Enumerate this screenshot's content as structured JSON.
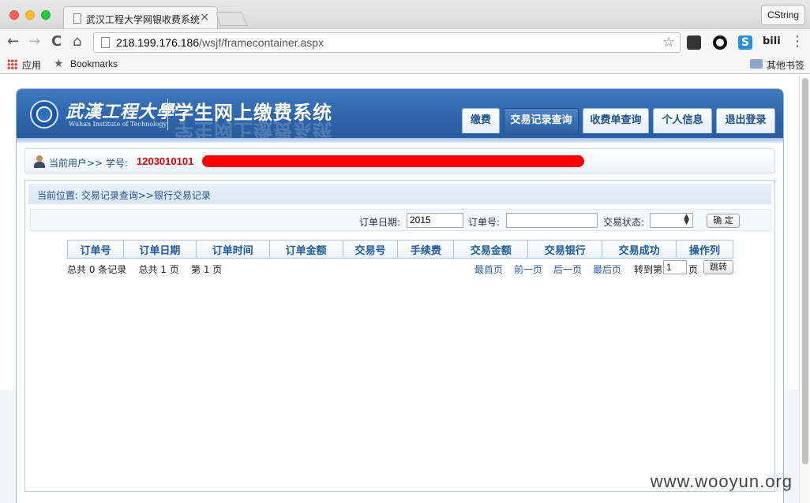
{
  "browser": {
    "tab_title": "武汉工程大学网银收费系统",
    "tab_close": "×",
    "profile_button": "CString",
    "url_host": "218.199.176.186",
    "url_path": "/wsjf/framecontainer.aspx",
    "nav_back": "←",
    "nav_forward": "→",
    "nav_reload": "C",
    "nav_home": "⌂",
    "bookmark_star": "☆",
    "ext_s": "S",
    "ext_bili": "bili",
    "menu": "⋮",
    "bookmarks": {
      "apps_label": "应用",
      "bookmarks_label": "Bookmarks",
      "other_label": "其他书签",
      "star": "★"
    }
  },
  "header": {
    "logo_cn": "武漢工程大學",
    "logo_en": "Wuhan Institute of Technology",
    "system_title": "学生网上缴费系统",
    "nav": {
      "pay": "缴费",
      "records": "交易记录查询",
      "receipts": "收费单查询",
      "profile": "个人信息",
      "logout": "退出登录"
    },
    "active_tab": "交易记录查询"
  },
  "user": {
    "label": "当前用户>> 学号:",
    "student_id": "1203010101"
  },
  "breadcrumb": "当前位置: 交易记录查询>>银行交易记录",
  "filter": {
    "date_label": "订单日期:",
    "date_value": "2015",
    "order_label": "订单号:",
    "order_value": "",
    "status_label": "交易状态:",
    "status_value": "",
    "confirm": "确 定"
  },
  "table": {
    "columns": [
      "订单号",
      "订单日期",
      "订单时间",
      "订单金额",
      "交易号",
      "手续费",
      "交易金额",
      "交易银行",
      "交易成功",
      "操作列"
    ],
    "rows": []
  },
  "pager": {
    "summary": "总共 0 条记录    总共 1 页    第 1 页",
    "first": "最首页",
    "prev": "前一页",
    "next": "后一页",
    "last": "最后页",
    "goto_label": "转到第",
    "goto_value": "1",
    "page_suffix": "页",
    "jump": "跳转"
  },
  "watermark": "www.wooyun.org",
  "colors": {
    "banner_blue": "#2e64aa",
    "link_blue": "#2a5ea8",
    "student_id_red": "#e00000",
    "redaction_red": "#ff0000"
  }
}
